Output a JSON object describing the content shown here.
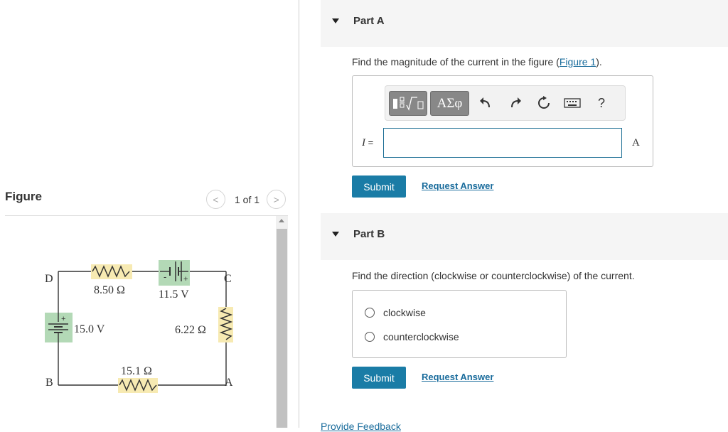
{
  "figure": {
    "title": "Figure",
    "pager_text": "1 of 1",
    "prev_glyph": "<",
    "next_glyph": ">",
    "circuit": {
      "node_labels": {
        "top_left": "D",
        "top_right": "C",
        "bottom_left": "B",
        "bottom_right": "A"
      },
      "r_top": "8.50 Ω",
      "battery_top": "11.5 V",
      "battery_left": "15.0 V",
      "r_right": "6.22 Ω",
      "r_bottom": "15.1 Ω",
      "battery_top_polarity": {
        "minus": "-",
        "plus": "+"
      },
      "battery_left_polarity": {
        "plus": "+"
      }
    },
    "colors": {
      "resistor_bg": "#f7eab2",
      "battery_bg": "#b3d9b6",
      "wire": "#333333"
    }
  },
  "partA": {
    "label": "Part A",
    "prompt_text": "Find the magnitude of the current in the figure (",
    "figure_link": "Figure 1",
    "prompt_end": ").",
    "toolbar": {
      "templates_icon": "templates-icon",
      "greek_label": "ΑΣφ",
      "help_label": "?"
    },
    "variable": "I",
    "equals": " =",
    "input_value": "",
    "unit": "A",
    "submit_label": "Submit",
    "request_label": "Request Answer"
  },
  "partB": {
    "label": "Part B",
    "prompt_text": "Find the direction (clockwise or counterclockwise) of the current.",
    "options": [
      "clockwise",
      "counterclockwise"
    ],
    "submit_label": "Submit",
    "request_label": "Request Answer"
  },
  "feedback_label": "Provide Feedback",
  "colors": {
    "accent": "#1a7ca6",
    "link": "#1a6c9c",
    "header_bg": "#f5f5f5"
  }
}
